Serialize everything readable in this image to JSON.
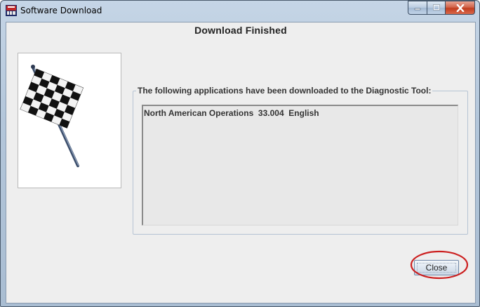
{
  "window": {
    "title": "Software Download",
    "icon": "app-icon",
    "caption_buttons": [
      "minimize-icon",
      "maximize-icon",
      "close-icon"
    ]
  },
  "dialog": {
    "heading": "Download Finished",
    "image": "checkered-flag",
    "group_label": "The following applications have been downloaded to the Diagnostic Tool:",
    "applications": [
      "North American Operations  33.004  English"
    ],
    "close_label": "Close"
  },
  "annotation": {
    "color": "#cc1f1f",
    "shape": "ellipse around Close button"
  }
}
